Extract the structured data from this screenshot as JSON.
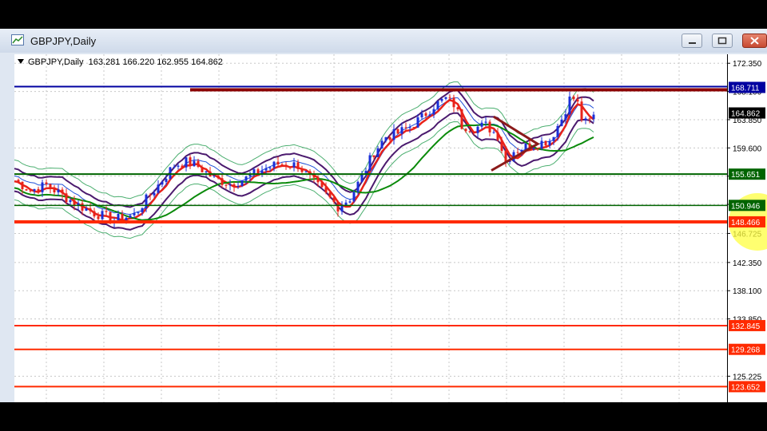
{
  "window": {
    "title": "GBPJPY,Daily"
  },
  "chart_header": {
    "symbol": "GBPJPY,Daily",
    "ohlc": "163.281 166.220 162.955 164.862"
  },
  "colors": {
    "grid": "#c8c8c8",
    "support": "#006400",
    "resistance_blue": "#0000a0",
    "resistance_dark": "#8b0000",
    "key_level": "#ff2a00",
    "lower_levels": "#ff2a00",
    "price_tag": "#000000",
    "highlight": "#ffff40",
    "pattern": "#8b1a1a"
  },
  "chart_data": {
    "type": "candlestick",
    "symbol": "GBPJPY",
    "timeframe": "Daily",
    "ylim": [
      121.3,
      173.7
    ],
    "yticks": [
      172.35,
      168.1,
      163.85,
      159.6,
      155.35,
      151.1,
      146.725,
      142.35,
      138.1,
      133.85,
      125.225
    ],
    "ytick_labels": [
      "172.350",
      "168.100",
      "163.850",
      "159.600",
      "155.325",
      "151.100",
      "146.725",
      "142.350",
      "138.100",
      "133.850",
      "125.225"
    ],
    "horizontal_levels": [
      {
        "value": 168.711,
        "label": "168.711",
        "color": "#0000a0"
      },
      {
        "value": 155.651,
        "label": "155.651",
        "color": "#006400"
      },
      {
        "value": 150.946,
        "label": "150.946",
        "color": "#006400"
      },
      {
        "value": 148.466,
        "label": "148.466",
        "color": "#ff2a00"
      },
      {
        "value": 132.845,
        "label": "132.845",
        "color": "#ff2a00"
      },
      {
        "value": 129.268,
        "label": "129.268",
        "color": "#ff2a00"
      },
      {
        "value": 123.652,
        "label": "123.652",
        "color": "#ff2a00"
      }
    ],
    "current_price": {
      "value": 164.862,
      "label": "164.862"
    },
    "price_path": [
      [
        0,
        154.8
      ],
      [
        20,
        153.2
      ],
      [
        40,
        154.0
      ],
      [
        60,
        152.5
      ],
      [
        80,
        151.0
      ],
      [
        100,
        149.8
      ],
      [
        125,
        148.8
      ],
      [
        150,
        149.5
      ],
      [
        165,
        151.8
      ],
      [
        180,
        154.0
      ],
      [
        200,
        157.0
      ],
      [
        215,
        157.5
      ],
      [
        230,
        156.8
      ],
      [
        250,
        155.0
      ],
      [
        270,
        154.2
      ],
      [
        290,
        155.0
      ],
      [
        310,
        156.3
      ],
      [
        330,
        157.2
      ],
      [
        355,
        157.0
      ],
      [
        370,
        155.0
      ],
      [
        390,
        152.5
      ],
      [
        405,
        150.8
      ],
      [
        420,
        152.0
      ],
      [
        435,
        155.3
      ],
      [
        450,
        159.0
      ],
      [
        465,
        161.3
      ],
      [
        480,
        161.8
      ],
      [
        495,
        162.8
      ],
      [
        510,
        164.2
      ],
      [
        525,
        166.0
      ],
      [
        540,
        167.0
      ],
      [
        552,
        166.0
      ],
      [
        560,
        163.0
      ],
      [
        575,
        162.6
      ],
      [
        590,
        163.0
      ],
      [
        605,
        161.5
      ],
      [
        615,
        157.5
      ],
      [
        625,
        159.2
      ],
      [
        640,
        159.8
      ],
      [
        655,
        160.3
      ],
      [
        670,
        160.8
      ],
      [
        685,
        164.0
      ],
      [
        697,
        167.5
      ],
      [
        705,
        166.2
      ],
      [
        712,
        163.2
      ],
      [
        720,
        163.6
      ],
      [
        728,
        164.86
      ]
    ]
  }
}
